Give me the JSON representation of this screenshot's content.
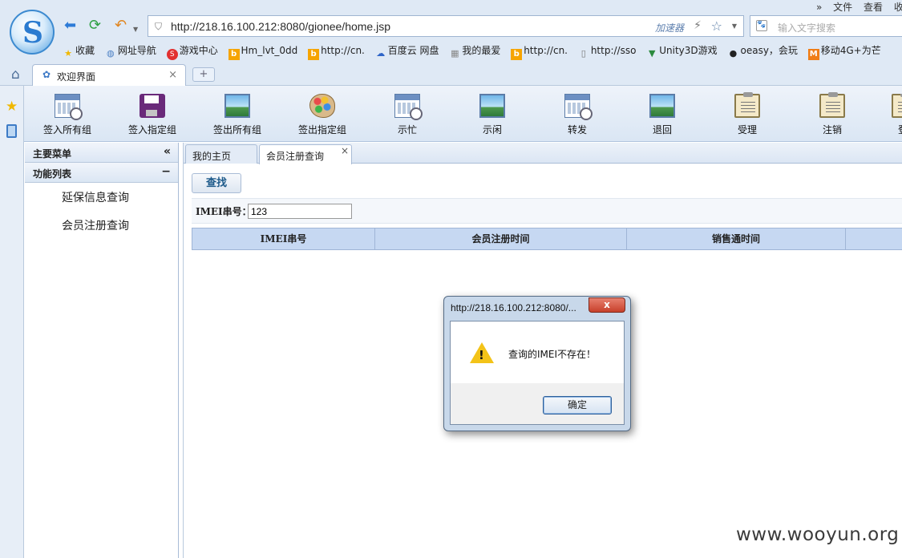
{
  "browser": {
    "logo_letter": "S",
    "url": "http://218.16.100.212:8080/gionee/home.jsp",
    "accelerator_label": "加速器",
    "search_placeholder": "输入文字搜索",
    "menu": [
      "»",
      "文件",
      "查看",
      "收"
    ],
    "bookmarks": [
      {
        "icon": "star-icon",
        "label": "收藏"
      },
      {
        "icon": "globe-icon",
        "label": "网址导航"
      },
      {
        "icon": "game-icon",
        "label": "游戏中心"
      },
      {
        "icon": "bing-icon",
        "label": "Hm_lvt_0dd"
      },
      {
        "icon": "bing-icon",
        "label": "http://cn."
      },
      {
        "icon": "baidu-cloud-icon",
        "label": "百度云 网盘"
      },
      {
        "icon": "grid-icon",
        "label": "我的最爱"
      },
      {
        "icon": "bing-icon",
        "label": "http://cn."
      },
      {
        "icon": "page-icon",
        "label": "http://sso"
      },
      {
        "icon": "unity-icon",
        "label": "Unity3D游戏"
      },
      {
        "icon": "github-icon",
        "label": "oeasy，会玩"
      },
      {
        "icon": "mobile-icon",
        "label": "移动4G+为芒"
      }
    ],
    "tab": {
      "title": "欢迎界面",
      "close": "×"
    },
    "new_tab": "+"
  },
  "toolbar": [
    {
      "label": "签入所有组",
      "icon": "calendar-clock-icon"
    },
    {
      "label": "签入指定组",
      "icon": "save-disk-icon"
    },
    {
      "label": "签出所有组",
      "icon": "landscape-image-icon"
    },
    {
      "label": "签出指定组",
      "icon": "palette-icon"
    },
    {
      "label": "示忙",
      "icon": "calendar-clock-icon"
    },
    {
      "label": "示闲",
      "icon": "landscape-image-icon"
    },
    {
      "label": "转发",
      "icon": "calendar-clock-icon"
    },
    {
      "label": "退回",
      "icon": "landscape-image-icon"
    },
    {
      "label": "受理",
      "icon": "clipboard-icon"
    },
    {
      "label": "注销",
      "icon": "clipboard-icon"
    },
    {
      "label": "登",
      "icon": "clipboard-icon"
    }
  ],
  "sidebar": {
    "header": "主要菜单",
    "collapse": "«",
    "section": "功能列表",
    "section_toggle": "−",
    "items": [
      {
        "label": "延保信息查询"
      },
      {
        "label": "会员注册查询"
      }
    ]
  },
  "content": {
    "tabs": [
      {
        "label": "我的主页"
      },
      {
        "label": "会员注册查询",
        "close": "×"
      }
    ],
    "find_button": "查找",
    "imei_label": "IMEI串号：",
    "imei_value": "123",
    "grid_columns": [
      "IMEI串号",
      "会员注册时间",
      "销售通时间",
      ""
    ]
  },
  "dialog": {
    "title": "http://218.16.100.212:8080/...",
    "close": "x",
    "message": "查询的IMEI不存在！",
    "ok": "确定"
  },
  "watermark": "www.wooyun.org"
}
